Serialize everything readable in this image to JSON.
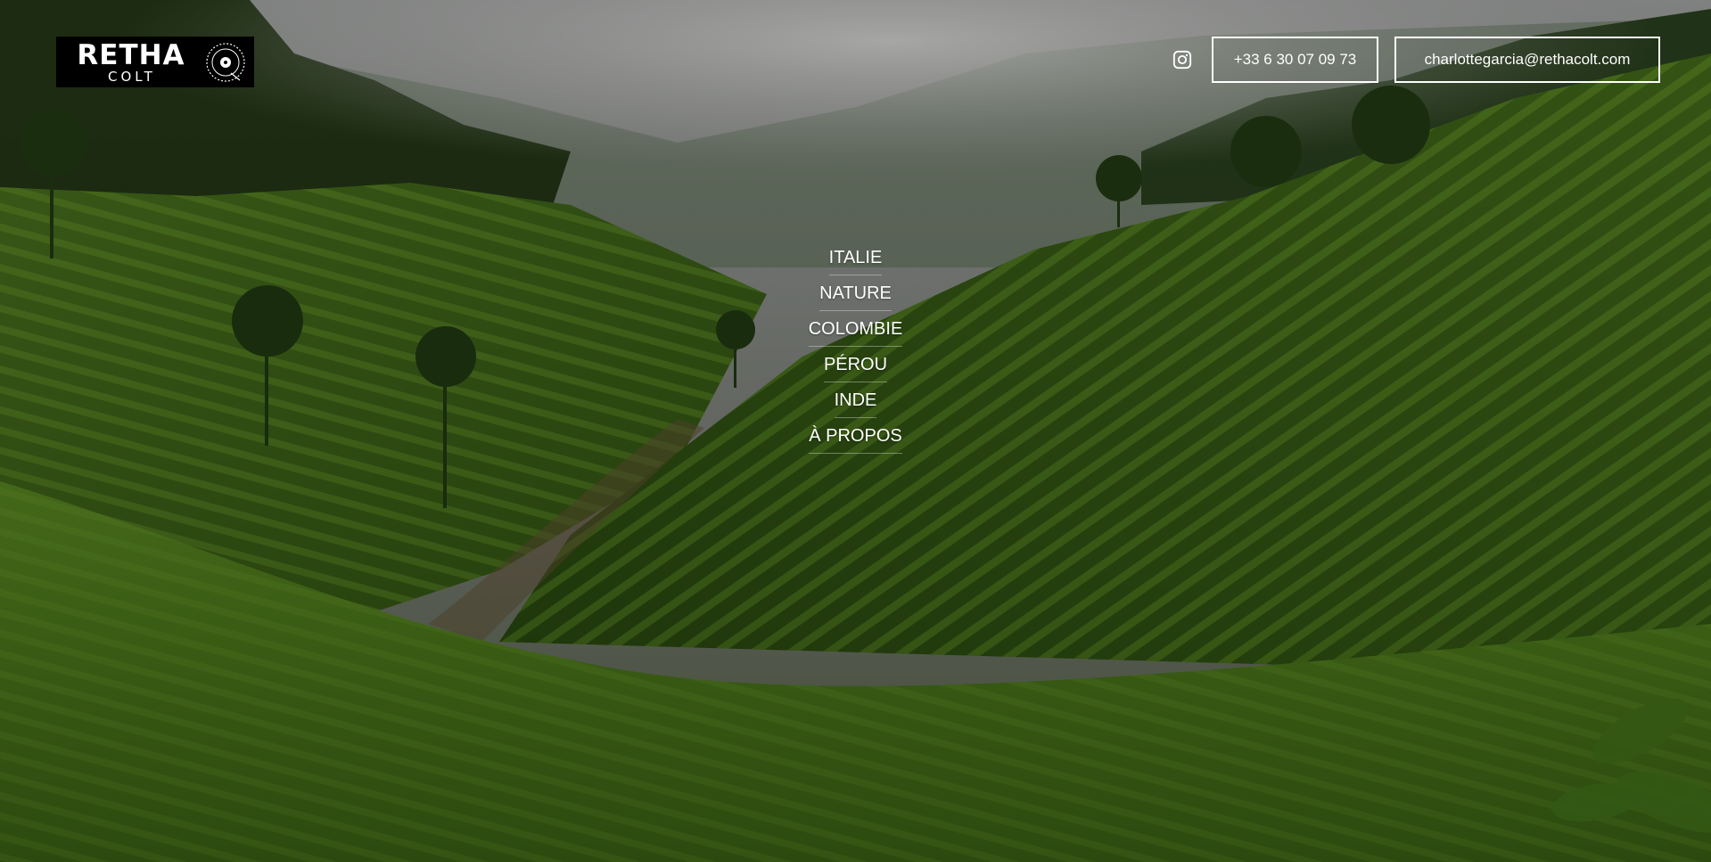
{
  "logo": {
    "main": "RETHA",
    "sub": "COLT",
    "emblem_icon": "record-seal-icon"
  },
  "header": {
    "instagram_icon": "instagram-icon",
    "phone": "+33 6 30 07 09 73",
    "email": "charlottegarcia@rethacolt.com"
  },
  "nav": {
    "items": [
      {
        "label": "ITALIE"
      },
      {
        "label": "NATURE"
      },
      {
        "label": "COLOMBIE"
      },
      {
        "label": "PÉROU"
      },
      {
        "label": "INDE"
      },
      {
        "label": "À PROPOS"
      }
    ]
  },
  "colors": {
    "text": "#ffffff",
    "logo_bg": "#000000",
    "foliage_dark": "#223a12",
    "foliage_light": "#5f8c22",
    "mist": "#9a9a98"
  }
}
